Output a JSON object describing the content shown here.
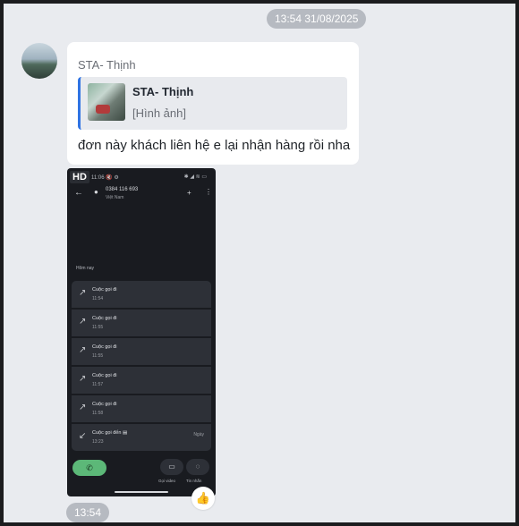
{
  "date_separator": "13:54 31/08/2025",
  "message": {
    "sender": "STA- Thịnh",
    "quote": {
      "name": "STA- Thịnh",
      "preview": "[Hình ảnh]"
    },
    "text": "đơn này khách liên hệ e lại nhận hàng rồi nha"
  },
  "image": {
    "badge": "HD",
    "screenshot": {
      "status_time": "11:06 🔇 ⚙",
      "status_icons": "✱ ◢ ≋ ▭",
      "phone_number": "0384 116 693",
      "country": "Việt Nam",
      "section": "Hôm nay",
      "calls": [
        {
          "label": "Cuộc gọi đi",
          "time": "11:54",
          "date": ""
        },
        {
          "label": "Cuộc gọi đi",
          "time": "11:55",
          "date": ""
        },
        {
          "label": "Cuộc gọi đi",
          "time": "11:55",
          "date": ""
        },
        {
          "label": "Cuộc gọi đi",
          "time": "11:57",
          "date": ""
        },
        {
          "label": "Cuộc gọi đi",
          "time": "11:58",
          "date": ""
        },
        {
          "label": "Cuộc gọi đến ▤",
          "time": "13:23",
          "date": "Ngày"
        }
      ],
      "video_label": "Gọi video",
      "message_label": "Tin nhắn"
    }
  },
  "message_time": "13:54"
}
